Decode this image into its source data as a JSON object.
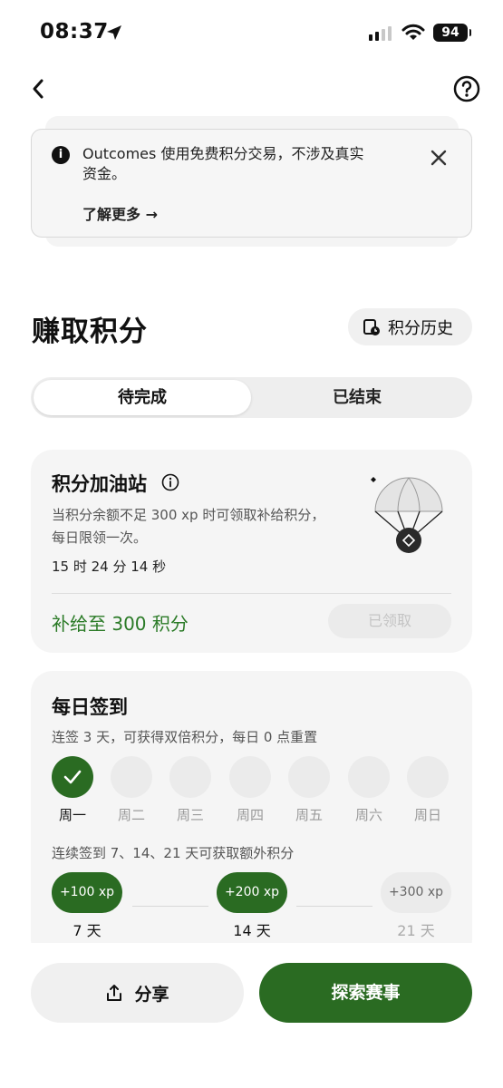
{
  "status_bar": {
    "time": "08:37",
    "battery": "94"
  },
  "banner": {
    "info_icon": "i",
    "text": "Outcomes 使用免费积分交易，不涉及真实资金。",
    "learn_more": "了解更多 →"
  },
  "header": {
    "title": "赚取积分",
    "history_label": "积分历史"
  },
  "tabs": [
    {
      "label": "待完成",
      "active": true
    },
    {
      "label": "已结束",
      "active": false
    }
  ],
  "refuel_card": {
    "title": "积分加油站",
    "description": "当积分余额不足 300 xp 时可领取补给积分，每日限领一次。",
    "countdown": "15 时 24 分 14 秒",
    "refill_text": "补给至 300 积分",
    "claimed_label": "已领取"
  },
  "checkin_card": {
    "title": "每日签到",
    "description": "连签 3 天，可获得双倍积分，每日 0 点重置",
    "days": [
      {
        "label": "周一",
        "done": true
      },
      {
        "label": "周二",
        "done": false
      },
      {
        "label": "周三",
        "done": false
      },
      {
        "label": "周四",
        "done": false
      },
      {
        "label": "周五",
        "done": false
      },
      {
        "label": "周六",
        "done": false
      },
      {
        "label": "周日",
        "done": false
      }
    ],
    "bonus_description": "连续签到 7、14、21 天可获取额外积分",
    "milestones": [
      {
        "reward": "+100 xp",
        "day": "7 天",
        "achieved": true
      },
      {
        "reward": "+200 xp",
        "day": "14 天",
        "achieved": true
      },
      {
        "reward": "+300 xp",
        "day": "21 天",
        "achieved": false
      }
    ]
  },
  "footer": {
    "share_label": "分享",
    "explore_label": "探索赛事"
  },
  "colors": {
    "accent_green": "#2a6b22",
    "refill_green": "#2a7a26",
    "card_bg": "#f5f5f5"
  },
  "icons": [
    "location-arrow-icon",
    "signal-icon",
    "wifi-icon",
    "battery-icon",
    "back-chevron-icon",
    "help-icon",
    "info-icon",
    "close-icon",
    "history-icon",
    "parachute-icon",
    "checkmark-icon",
    "share-icon"
  ]
}
